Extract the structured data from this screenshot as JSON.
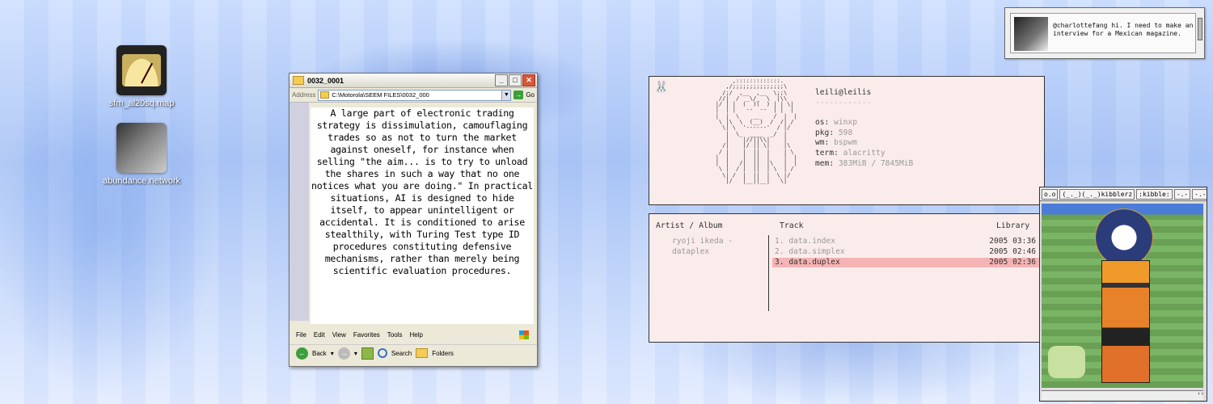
{
  "desktop": {
    "icons": [
      {
        "label": "sfm_al20sq.map"
      },
      {
        "label": "abundance.network"
      }
    ]
  },
  "explorer": {
    "title": "0032_0001",
    "address_label": "Address",
    "address": "C:\\Motorola\\SEEM FILES\\0032_000",
    "go_label": "Go",
    "body_text": "A large part of electronic trading strategy is dissimulation, camouflaging trades so as not to turn the market against oneself, for instance when selling \"the aim... is to try to unload the shares in such a way that no one notices what you are doing.\" In practical situations, AI is designed to hide itself, to appear unintelligent or accidental. It is conditioned to arise stealthily, with Turing Test type ID procedures constituting defensive mechanisms, rather than merely being scientific evaluation procedures.",
    "menu": [
      "File",
      "Edit",
      "View",
      "Favorites",
      "Tools",
      "Help"
    ],
    "toolbar": {
      "back": "Back",
      "search": "Search",
      "folders": "Folders"
    }
  },
  "neofetch": {
    "user": "leili@leilis",
    "separator": "------------",
    "rows": [
      {
        "key": "os:",
        "value": "winxp"
      },
      {
        "key": "pkg:",
        "value": "598"
      },
      {
        "key": "wm:",
        "value": "bspwm"
      },
      {
        "key": "term:",
        "value": "alacritty"
      },
      {
        "key": "mem:",
        "value": "383MiB / 7845MiB"
      }
    ]
  },
  "music": {
    "headers": {
      "artist": "Artist / Album",
      "track": "Track",
      "library": "Library"
    },
    "artist_line1": "ryoji ikeda -",
    "artist_line2": "dataplex",
    "tracks": [
      {
        "name": "1. data.index",
        "date": "2005 03:36"
      },
      {
        "name": "2. data.simplex",
        "date": "2005 02:46"
      },
      {
        "name": "3. data.duplex",
        "date": "2005 02:36"
      }
    ],
    "selected_index": 2
  },
  "notification": {
    "message": "@charlottefang hi. I need to make an interview for a Mexican magazine."
  },
  "viewer": {
    "tabs": [
      "o.o",
      "(_._)(_._)kibblerz",
      ":kibble:",
      "-.-",
      "-.-",
      "+"
    ]
  },
  "colors": {
    "selected_track": "#f4b4b4",
    "panel_bg": "#fbecec"
  }
}
